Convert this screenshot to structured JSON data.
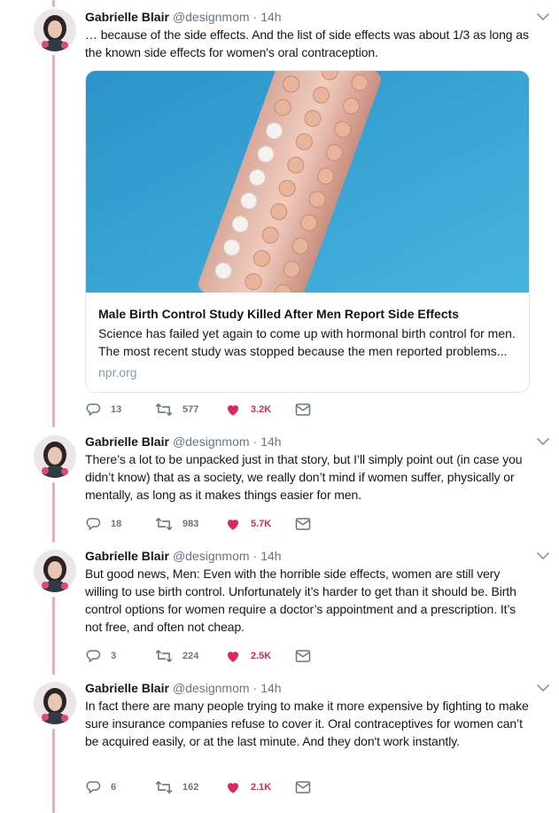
{
  "colors": {
    "thread_line": "#f4a6c0",
    "like_active": "#e0245e",
    "secondary_text": "#657786",
    "card_image_bg": "#3aa7d6"
  },
  "tweets": [
    {
      "name": "Gabrielle Blair",
      "handle": "@designmom",
      "separator": "·",
      "time": "14h",
      "text": "… because of the side effects. And the list of side effects was about 1/3 as long as the known side effects for women's oral contraception.",
      "card": {
        "title": "Male Birth Control Study Killed After Men Report Side Effects",
        "description": "Science has failed yet again to come up with hormonal birth control for men. The most recent study was stopped because the men reported problems...",
        "domain": "npr.org",
        "image_icon": "birth-control-pill-pack-photo"
      },
      "replies": "13",
      "retweets": "577",
      "likes": "3.2K",
      "liked": true
    },
    {
      "name": "Gabrielle Blair",
      "handle": "@designmom",
      "separator": "·",
      "time": "14h",
      "text": "There’s a lot to be unpacked just in that story, but I’ll simply point out (in case you didn’t know) that as a society, we really don’t mind if women suffer, physically or mentally, as long as it makes things easier for men.",
      "replies": "18",
      "retweets": "983",
      "likes": "5.7K",
      "liked": true
    },
    {
      "name": "Gabrielle Blair",
      "handle": "@designmom",
      "separator": "·",
      "time": "14h",
      "text": "But good news, Men: Even with the horrible side effects, women are still very willing to use birth control. Unfortunately it’s harder to get than it should be. Birth control options for women require a doctor’s appointment and a prescription. It’s not free, and often not cheap.",
      "replies": "3",
      "retweets": "224",
      "likes": "2.5K",
      "liked": true
    },
    {
      "name": "Gabrielle Blair",
      "handle": "@designmom",
      "separator": "·",
      "time": "14h",
      "text": "In fact there are many people trying to make it more expensive by fighting to make sure insurance companies refuse to cover it. Oral contraceptives for women can’t be acquired easily, or at the last minute. And they don't work instantly.",
      "replies": "6",
      "retweets": "162",
      "likes": "2.1K",
      "liked": true
    }
  ]
}
